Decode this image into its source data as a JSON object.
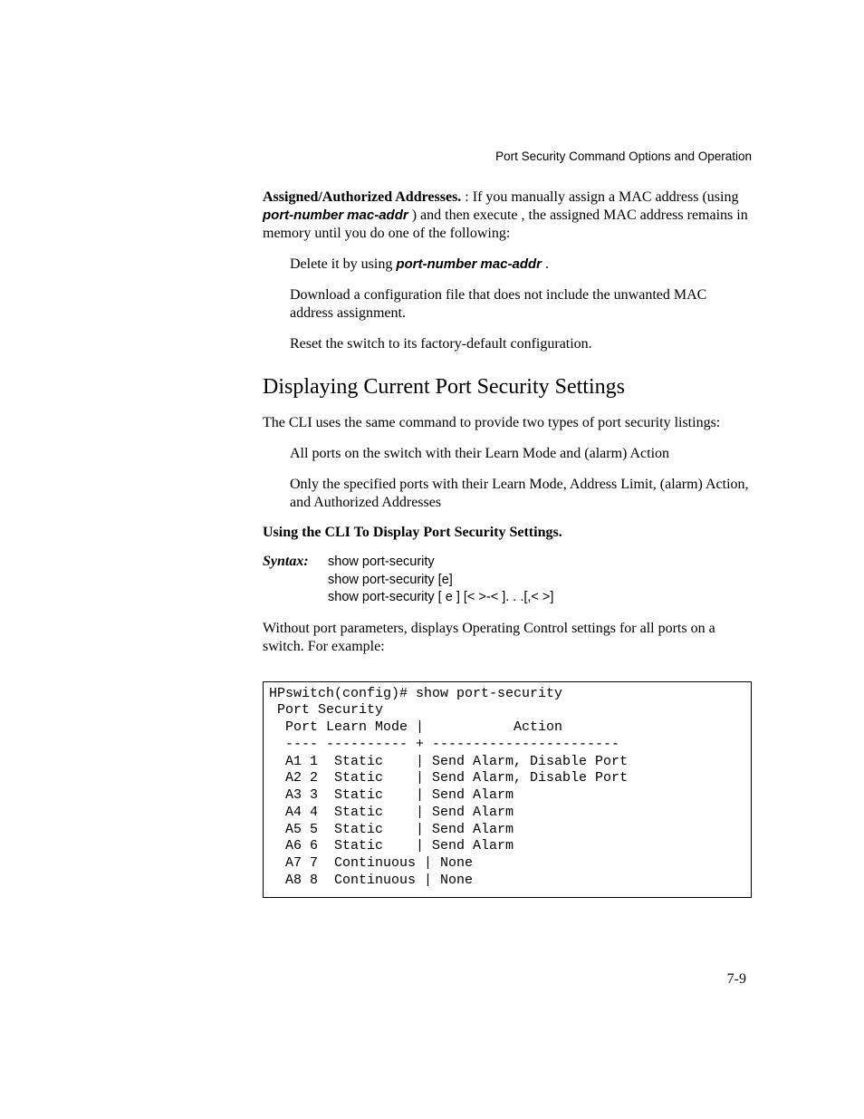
{
  "running_head": "Port Security Command Options and Operation",
  "p1_lead": "Assigned/Authorized Addresses.",
  "p1_a": " : If you manually assign a MAC address (using ",
  "p1_pn": "port-number",
  "p1_b": " ",
  "p1_ma": "mac-addr",
  "p1_c": " ) and then execute ",
  "p1_d": ", the assigned MAC address remains in memory until you do one of the following:",
  "li1_a": "Delete it by using ",
  "li1_pn": "port-number",
  "li1_gap": " ",
  "li1_ma": "mac-addr",
  "li1_end": " .",
  "li2": "Download a configuration file that does not include the unwanted MAC address assignment.",
  "li3": "Reset the switch to its factory-default configuration.",
  "h2": "Displaying Current Port Security Settings",
  "p2": "The CLI uses the same command to provide two types of port security listings:",
  "li4": "All ports on the switch with their Learn Mode and (alarm) Action",
  "li5": "Only the specified ports with their Learn Mode, Address Limit, (alarm) Action, and Authorized Addresses",
  "subhead": "Using the CLI To Display Port Security Settings.",
  "syntax_label": "Syntax:",
  "syntax_l1": "show port-security",
  "syntax_l2": "show port-security [e]",
  "syntax_l3": "show port-security [ e ] [<                    >-<                 ]. . .[,<                  >]",
  "p3_a": "Without port parameters, ",
  "p3_b": " displays Operating Control settings for all ports on a switch. For example:",
  "code": "HPswitch(config)# show port-security\n Port Security\n  Port Learn Mode |           Action\n  ---- ---------- + -----------------------\n  A1 1  Static    | Send Alarm, Disable Port\n  A2 2  Static    | Send Alarm, Disable Port\n  A3 3  Static    | Send Alarm\n  A4 4  Static    | Send Alarm\n  A5 5  Static    | Send Alarm\n  A6 6  Static    | Send Alarm\n  A7 7  Continuous | None\n  A8 8  Continuous | None",
  "page_num": "7-9"
}
